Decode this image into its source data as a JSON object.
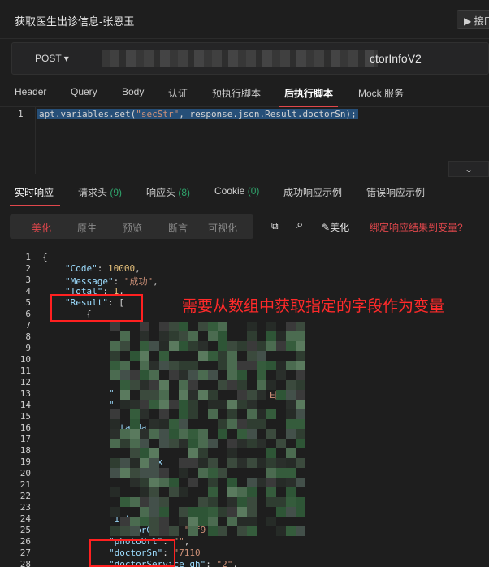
{
  "window": {
    "title": "获取医生出诊信息-张恩玉",
    "interface_button": "▶ 接口"
  },
  "request": {
    "method": "POST ▾",
    "url_tail": "ctorInfoV2"
  },
  "request_tabs": [
    {
      "label": "Header"
    },
    {
      "label": "Query"
    },
    {
      "label": "Body"
    },
    {
      "label": "认证"
    },
    {
      "label": "预执行脚本"
    },
    {
      "label": "后执行脚本",
      "active": true
    },
    {
      "label": "Mock 服务"
    }
  ],
  "script_editor": {
    "line_number": "1",
    "code_prefix": "apt.variables.set(",
    "code_string": "\"secStr\"",
    "code_suffix": ", response.json.Result.doctorSn);"
  },
  "collapse_icon": "⌄",
  "response_tabs": [
    {
      "label": "实时响应",
      "active": true
    },
    {
      "label": "请求头",
      "count": "(9)"
    },
    {
      "label": "响应头",
      "count": "(8)"
    },
    {
      "label": "Cookie",
      "count": "(0)"
    },
    {
      "label": "成功响应示例"
    },
    {
      "label": "错误响应示例"
    }
  ],
  "view_modes": [
    {
      "label": "美化",
      "active": true
    },
    {
      "label": "原生"
    },
    {
      "label": "预览"
    },
    {
      "label": "断言"
    },
    {
      "label": "可视化"
    }
  ],
  "tools": {
    "copy_icon": "⧉",
    "search_icon": "⌕",
    "beautify_label": "美化",
    "beautify_icon": "✎"
  },
  "bind_link": "绑定响应结果到变量?",
  "annotation": "需要从数组中获取指定的字段作为变量",
  "response_lines": [
    {
      "n": "1",
      "t": "{"
    },
    {
      "n": "2",
      "key": "\"Code\"",
      "sep": ": ",
      "num": "10000",
      "end": ","
    },
    {
      "n": "3",
      "key": "\"Message\"",
      "sep": ": ",
      "str": "\"成功\"",
      "end": ","
    },
    {
      "n": "4",
      "key": "\"Total\"",
      "sep": ": ",
      "num": "1",
      "end": ","
    },
    {
      "n": "5",
      "key": "\"Result\"",
      "sep": ": ",
      "end": "["
    },
    {
      "n": "6",
      "t": "{"
    },
    {
      "n": "7"
    },
    {
      "n": "8"
    },
    {
      "n": "9"
    },
    {
      "n": "10"
    },
    {
      "n": "11"
    },
    {
      "n": "12"
    },
    {
      "n": "13",
      "key": "\"",
      "str": "E院\"",
      "end": ","
    },
    {
      "n": "14",
      "key": "\""
    },
    {
      "n": "15",
      "key": "\"d"
    },
    {
      "n": "16",
      "key": "\"standa"
    },
    {
      "n": "17"
    },
    {
      "n": "18"
    },
    {
      "n": "19",
      "key": "\"doctorSex"
    },
    {
      "n": "20",
      "key": "\""
    },
    {
      "n": "21"
    },
    {
      "n": "22"
    },
    {
      "n": "23"
    },
    {
      "n": "24",
      "key": "\"intro"
    },
    {
      "n": "25",
      "key": "\"doctorGuid\"",
      "sep": ": ",
      "str": "\"9f9"
    },
    {
      "n": "26",
      "key": "\"photoUrl\"",
      "sep": ": ",
      "str": "\"\"",
      "end": ","
    },
    {
      "n": "27",
      "key": "\"doctorSn\"",
      "sep": ": ",
      "str": "\"7110"
    },
    {
      "n": "28",
      "key": "\"doctorService_gh\"",
      "sep": ": ",
      "str": "\"2\"",
      "end": ","
    }
  ]
}
